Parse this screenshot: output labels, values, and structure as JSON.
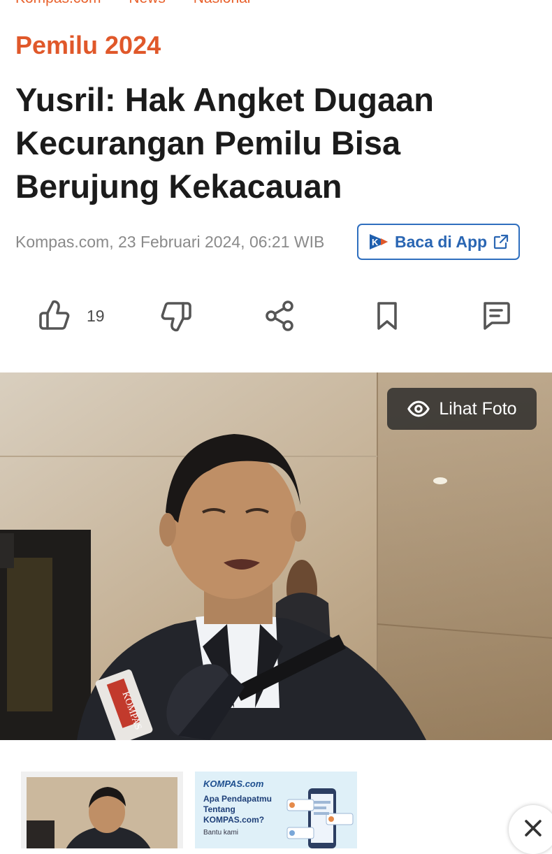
{
  "breadcrumb": {
    "items": [
      "Kompas.com",
      "News",
      "Nasional"
    ]
  },
  "article": {
    "category": "Pemilu 2024",
    "title": "Yusril: Hak Angket Dugaan Kecurangan Pemilu Bisa Berujung Kekacauan",
    "meta": "Kompas.com, 23 Februari 2024, 06:21 WIB"
  },
  "app_button": {
    "label": "Baca di App",
    "logo_letter": "K"
  },
  "actions": {
    "like_count": "19"
  },
  "photo": {
    "lihat_foto_label": "Lihat Foto",
    "mic_text": "KOMPAS"
  },
  "promo": {
    "brand": "KOMPAS.com",
    "headline": "Apa Pendapatmu Tentang KOMPAS.com?",
    "sub": "Bantu kami"
  },
  "colors": {
    "accent": "#e0582a",
    "app_blue": "#2f6fbf",
    "text": "#1b1b1b",
    "meta": "#8a8a8a"
  },
  "icons": [
    "thumbs-up-icon",
    "thumbs-down-icon",
    "share-icon",
    "bookmark-icon",
    "comment-icon",
    "eye-icon",
    "external-link-icon",
    "close-icon"
  ]
}
